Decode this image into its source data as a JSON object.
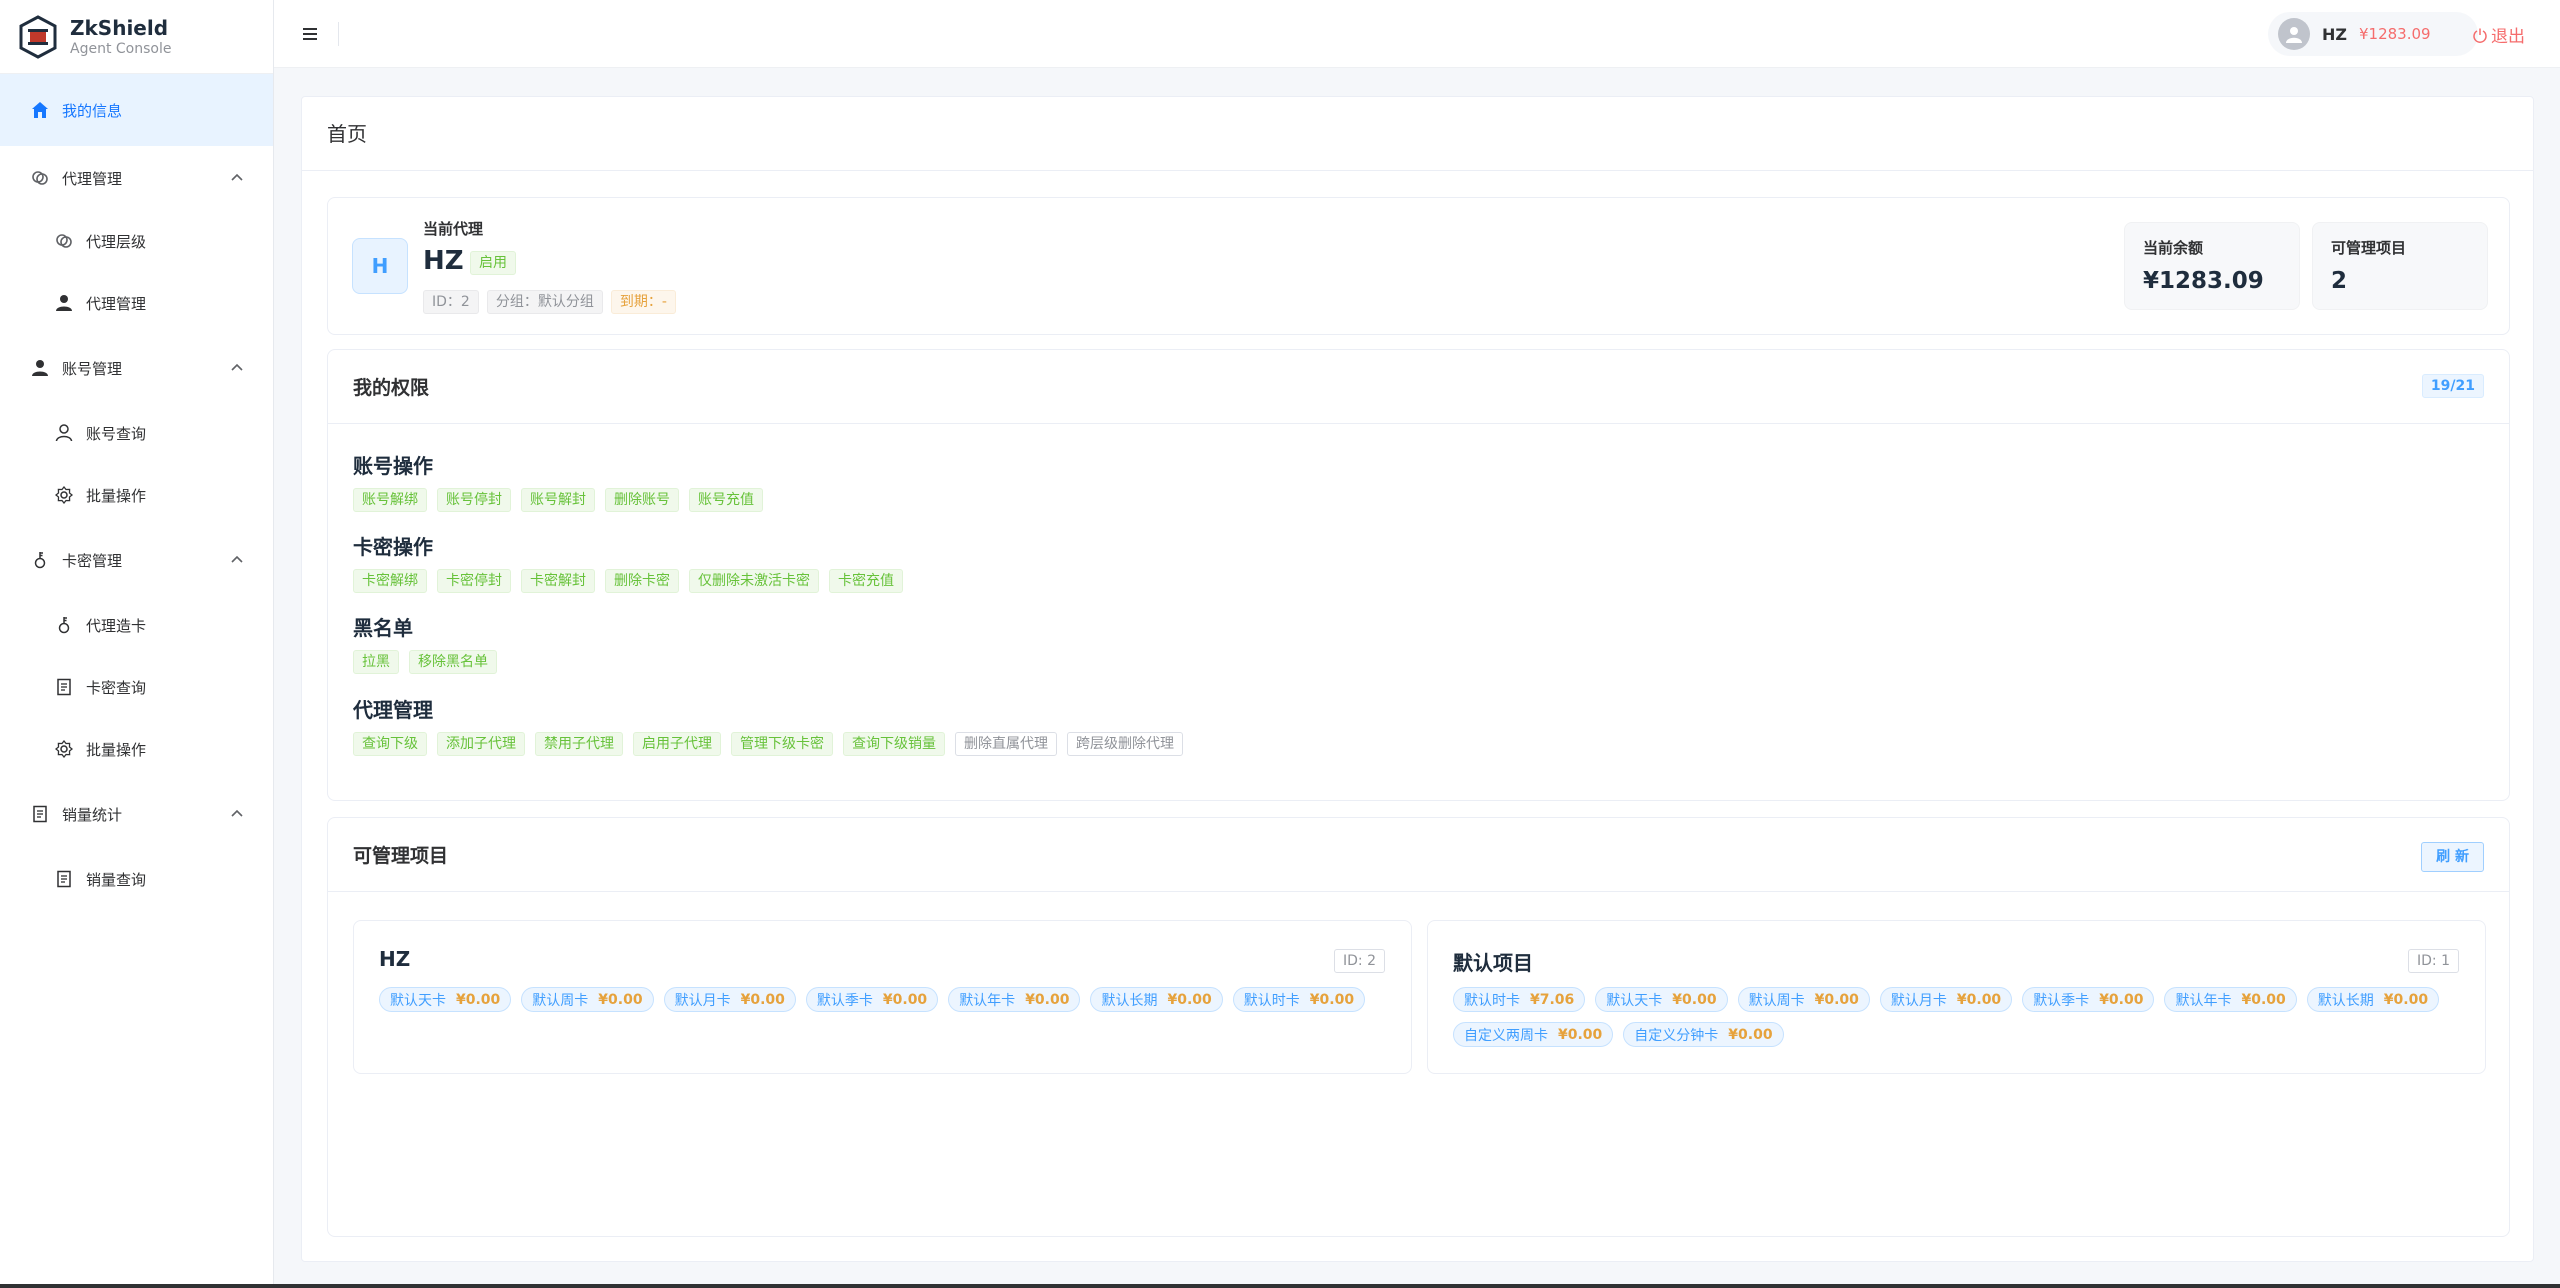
{
  "brand": {
    "name": "ZkShield",
    "subtitle": "Agent Console"
  },
  "sidebar": {
    "items": [
      {
        "label": "我的信息",
        "icon": "home-icon",
        "active": true
      },
      {
        "label": "代理管理",
        "icon": "link-icon",
        "expanded": true
      },
      {
        "label": "代理层级",
        "icon": "link-icon",
        "sub": true
      },
      {
        "label": "代理管理",
        "icon": "user-icon",
        "sub": true
      },
      {
        "label": "账号管理",
        "icon": "user-icon",
        "expanded": true
      },
      {
        "label": "账号查询",
        "icon": "user-outline-icon",
        "sub": true
      },
      {
        "label": "批量操作",
        "icon": "gear-icon",
        "sub": true
      },
      {
        "label": "卡密管理",
        "icon": "key-icon",
        "expanded": true
      },
      {
        "label": "代理造卡",
        "icon": "key-icon",
        "sub": true
      },
      {
        "label": "卡密查询",
        "icon": "document-icon",
        "sub": true
      },
      {
        "label": "批量操作",
        "icon": "gear-icon",
        "sub": true
      },
      {
        "label": "销量统计",
        "icon": "document-icon",
        "expanded": true
      },
      {
        "label": "销量查询",
        "icon": "document-icon",
        "sub": true
      }
    ]
  },
  "header": {
    "user_name": "HZ",
    "balance": "¥1283.09",
    "logout_label": "退出"
  },
  "page": {
    "title": "首页"
  },
  "agent": {
    "section_label": "当前代理",
    "avatar_letter": "H",
    "name": "HZ",
    "status": "启用",
    "id_tag": "ID：2",
    "group_tag": "分组：默认分组",
    "expire_tag": "到期：-",
    "balance_label": "当前余额",
    "balance_value": "¥1283.09",
    "projects_label": "可管理项目",
    "projects_value": "2"
  },
  "permissions": {
    "title": "我的权限",
    "count": "19/21",
    "groups": [
      {
        "title": "账号操作",
        "tags": [
          {
            "label": "账号解绑",
            "on": true
          },
          {
            "label": "账号停封",
            "on": true
          },
          {
            "label": "账号解封",
            "on": true
          },
          {
            "label": "删除账号",
            "on": true
          },
          {
            "label": "账号充值",
            "on": true
          }
        ]
      },
      {
        "title": "卡密操作",
        "tags": [
          {
            "label": "卡密解绑",
            "on": true
          },
          {
            "label": "卡密停封",
            "on": true
          },
          {
            "label": "卡密解封",
            "on": true
          },
          {
            "label": "删除卡密",
            "on": true
          },
          {
            "label": "仅删除未激活卡密",
            "on": true
          },
          {
            "label": "卡密充值",
            "on": true
          }
        ]
      },
      {
        "title": "黑名单",
        "tags": [
          {
            "label": "拉黑",
            "on": true
          },
          {
            "label": "移除黑名单",
            "on": true
          }
        ]
      },
      {
        "title": "代理管理",
        "tags": [
          {
            "label": "查询下级",
            "on": true
          },
          {
            "label": "添加子代理",
            "on": true
          },
          {
            "label": "禁用子代理",
            "on": true
          },
          {
            "label": "启用子代理",
            "on": true
          },
          {
            "label": "管理下级卡密",
            "on": true
          },
          {
            "label": "查询下级销量",
            "on": true
          },
          {
            "label": "删除直属代理",
            "on": false
          },
          {
            "label": "跨层级删除代理",
            "on": false
          }
        ]
      }
    ]
  },
  "projects": {
    "title": "可管理项目",
    "refresh_label": "刷 新",
    "cards": [
      {
        "name": "HZ",
        "id": "ID: 2",
        "prices": [
          {
            "name": "默认天卡",
            "value": "¥0.00"
          },
          {
            "name": "默认周卡",
            "value": "¥0.00"
          },
          {
            "name": "默认月卡",
            "value": "¥0.00"
          },
          {
            "name": "默认季卡",
            "value": "¥0.00"
          },
          {
            "name": "默认年卡",
            "value": "¥0.00"
          },
          {
            "name": "默认长期",
            "value": "¥0.00"
          },
          {
            "name": "默认时卡",
            "value": "¥0.00"
          }
        ]
      },
      {
        "name": "默认项目",
        "id": "ID: 1",
        "prices": [
          {
            "name": "默认时卡",
            "value": "¥7.06"
          },
          {
            "name": "默认天卡",
            "value": "¥0.00"
          },
          {
            "name": "默认周卡",
            "value": "¥0.00"
          },
          {
            "name": "默认月卡",
            "value": "¥0.00"
          },
          {
            "name": "默认季卡",
            "value": "¥0.00"
          },
          {
            "name": "默认年卡",
            "value": "¥0.00"
          },
          {
            "name": "默认长期",
            "value": "¥0.00"
          },
          {
            "name": "自定义两周卡",
            "value": "¥0.00"
          },
          {
            "name": "自定义分钟卡",
            "value": "¥0.00"
          }
        ]
      }
    ]
  },
  "colors": {
    "accent": "#409eff",
    "active_bg": "#e8f3ff",
    "danger": "#f56c6c",
    "success": "#67c23a",
    "warning": "#e6a23c"
  }
}
